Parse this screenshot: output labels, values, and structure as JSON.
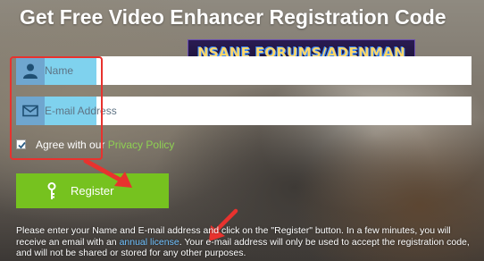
{
  "page": {
    "title": "Get Free Video Enhancer Registration Code",
    "watermark": "NSANE FORUMS/ADENMAN"
  },
  "form": {
    "name_placeholder": "Name",
    "email_placeholder": "E-mail Address",
    "agree_prefix": "Agree with our ",
    "privacy_link": "Privacy Policy",
    "agree_checked": true,
    "register_label": "Register"
  },
  "info": {
    "part1": "Please enter your Name and E-mail address and click on the \"Register\" button. In a few minutes, you will receive an email with an ",
    "link": "annual license",
    "part2": ". Your e-mail address will only be used to accept the registration code, and will not be shared or stored for any other purposes."
  },
  "colors": {
    "accent_green": "#76c21f",
    "icon_blue": "#6fa6cf",
    "annotation_red": "#e8322e",
    "link_blue": "#6fc1ff"
  },
  "icons": [
    "user-icon",
    "mail-icon",
    "checkmark-icon",
    "key-icon",
    "annotation-arrow"
  ]
}
